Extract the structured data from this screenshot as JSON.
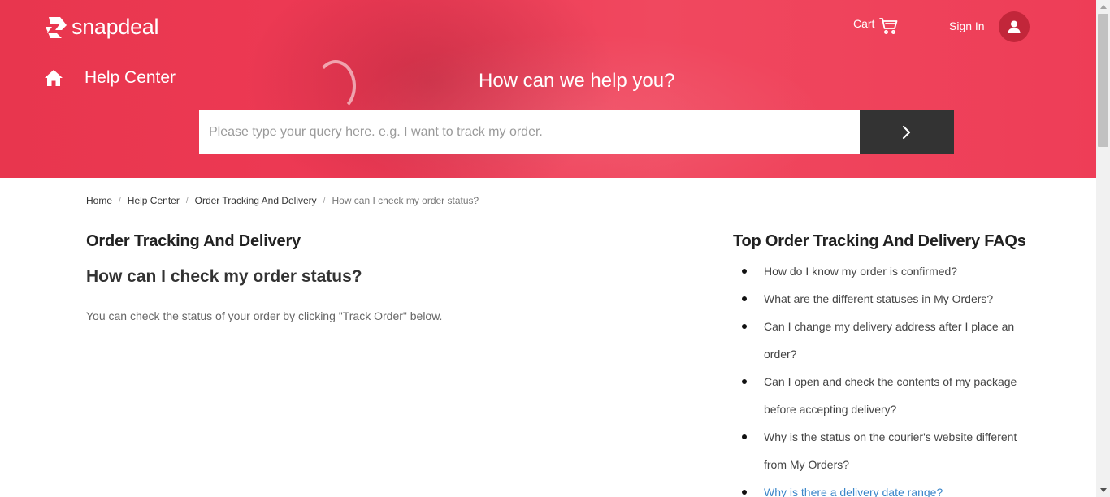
{
  "brand": {
    "logo_text": "snapdeal",
    "accent": "#e8364e",
    "dark": "#333333"
  },
  "header": {
    "cart_label": "Cart",
    "signin_label": "Sign In",
    "help_center_label": "Help Center",
    "hero_question": "How can we help you?"
  },
  "search": {
    "placeholder": "Please type your query here. e.g. I want to track my order.",
    "value": ""
  },
  "breadcrumb": {
    "items": [
      "Home",
      "Help Center",
      "Order Tracking And Delivery"
    ],
    "current": "How can I check my order status?"
  },
  "article": {
    "category": "Order Tracking And Delivery",
    "question": "How can I check my order status?",
    "answer": "You can check the status of your order by clicking \"Track Order\" below."
  },
  "faq": {
    "title": "Top Order Tracking And Delivery FAQs",
    "items": [
      "How do I know my order is confirmed?",
      "What are the different statuses in My Orders?",
      "Can I change my delivery address after I place an order?",
      "Can I open and check the contents of my package before accepting delivery?",
      "Why is the status on the courier's website different from My Orders?",
      "Why is there a delivery date range?"
    ]
  },
  "icons": {
    "logo": "snapdeal-logo-icon",
    "cart": "cart-icon",
    "user": "user-icon",
    "home": "home-icon",
    "search_submit": "chevron-right-icon"
  }
}
